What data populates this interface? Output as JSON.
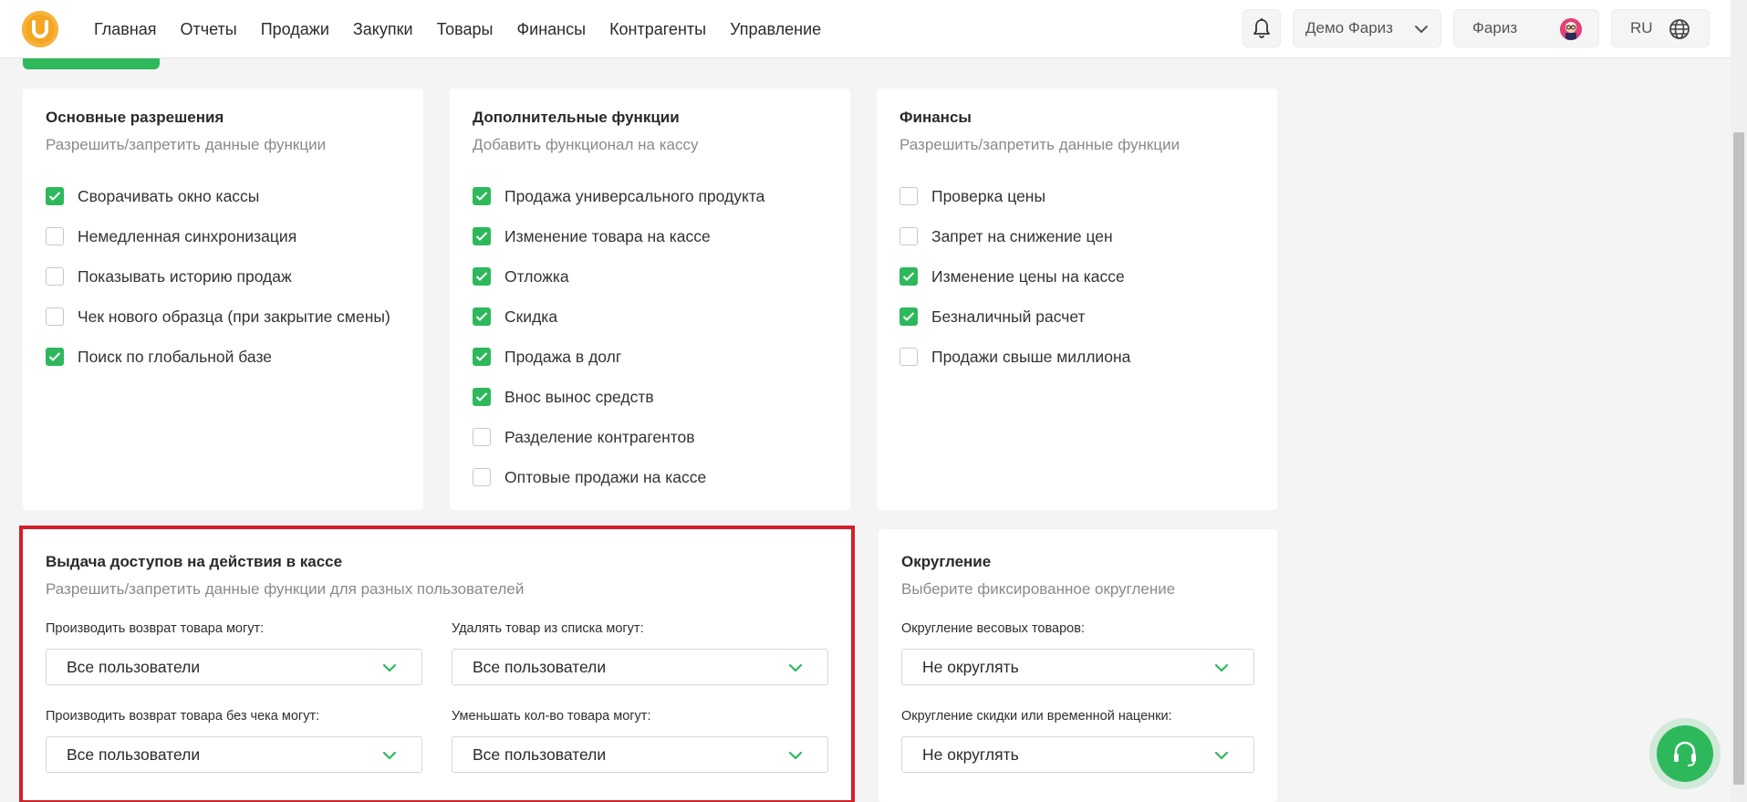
{
  "nav": {
    "items": [
      "Главная",
      "Отчеты",
      "Продажи",
      "Закупки",
      "Товары",
      "Финансы",
      "Контрагенты",
      "Управление"
    ]
  },
  "header": {
    "company": "Демо Фариз",
    "user": "Фариз",
    "lang": "RU"
  },
  "cards": {
    "basic": {
      "title": "Основные разрешения",
      "subtitle": "Разрешить/запретить данные функции",
      "items": [
        {
          "label": "Сворачивать окно кассы",
          "checked": true
        },
        {
          "label": "Немедленная синхронизация",
          "checked": false
        },
        {
          "label": "Показывать историю продаж",
          "checked": false
        },
        {
          "label": "Чек нового образца (при закрытие смены)",
          "checked": false
        },
        {
          "label": "Поиск по глобальной базе",
          "checked": true
        }
      ]
    },
    "extra": {
      "title": "Дополнительные функции",
      "subtitle": "Добавить функционал на кассу",
      "items": [
        {
          "label": "Продажа универсального продукта",
          "checked": true
        },
        {
          "label": "Изменение товара на кассе",
          "checked": true
        },
        {
          "label": "Отложка",
          "checked": true
        },
        {
          "label": "Скидка",
          "checked": true
        },
        {
          "label": "Продажа в долг",
          "checked": true
        },
        {
          "label": "Внос вынос средств",
          "checked": true
        },
        {
          "label": "Разделение контрагентов",
          "checked": false
        },
        {
          "label": "Оптовые продажи на кассе",
          "checked": false
        }
      ]
    },
    "finance": {
      "title": "Финансы",
      "subtitle": "Разрешить/запретить данные функции",
      "items": [
        {
          "label": "Проверка цены",
          "checked": false
        },
        {
          "label": "Запрет на снижение цен",
          "checked": false
        },
        {
          "label": "Изменение цены на кассе",
          "checked": true
        },
        {
          "label": "Безналичный расчет",
          "checked": true
        },
        {
          "label": "Продажи свыше миллиона",
          "checked": false
        }
      ]
    },
    "access": {
      "title": "Выдача доступов на действия в кассе",
      "subtitle": "Разрешить/запретить данные функции для разных пользователей",
      "fields": [
        {
          "label": "Производить возврат товара могут:",
          "value": "Все пользователи"
        },
        {
          "label": "Удалять товар из списка могут:",
          "value": "Все пользователи"
        },
        {
          "label": "Производить возврат товара без чека могут:",
          "value": "Все пользователи"
        },
        {
          "label": "Уменьшать кол-во товара могут:",
          "value": "Все пользователи"
        }
      ]
    },
    "rounding": {
      "title": "Округление",
      "subtitle": "Выберите фиксированное округление",
      "fields": [
        {
          "label": "Округление весовых товаров:",
          "value": "Не округлять"
        },
        {
          "label": "Округление скидки или временной наценки:",
          "value": "Не округлять"
        }
      ]
    }
  },
  "colors": {
    "accent": "#2eb85c",
    "highlight": "#d21f2a",
    "logo": "#f5a623"
  },
  "icons": [
    "logo-icon",
    "bell-icon",
    "chevron-down-icon",
    "avatar",
    "globe-icon",
    "checkmark-icon",
    "headset-icon"
  ]
}
